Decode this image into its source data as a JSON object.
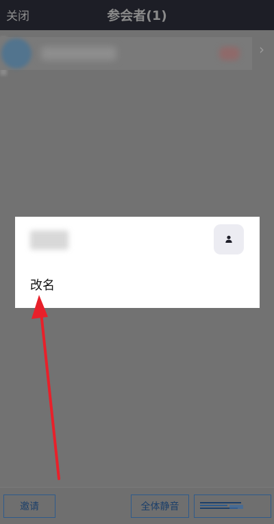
{
  "header": {
    "close_label": "关闭",
    "title": "参会者(1)"
  },
  "participant": {
    "chevron": "›"
  },
  "dialog": {
    "rename_label": "改名",
    "profile_icon": "person-icon"
  },
  "bottom_bar": {
    "invite_label": "邀请",
    "mute_all_label": "全体静音"
  },
  "annotation": {
    "arrow_color": "#e8202a"
  }
}
